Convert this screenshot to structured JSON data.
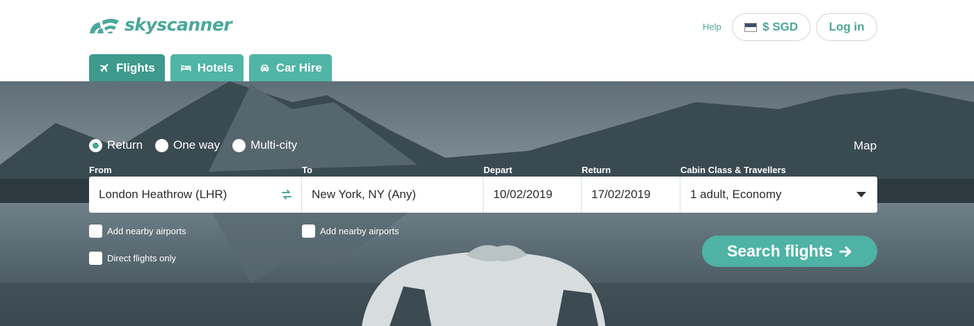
{
  "brand": {
    "name": "skyscanner",
    "accent_color": "#4aa79a"
  },
  "header": {
    "help": "Help",
    "currency": "$ SGD",
    "currency_icon": "flag-icon",
    "login": "Log in"
  },
  "tabs": [
    {
      "label": "Flights",
      "icon": "plane-icon",
      "active": true
    },
    {
      "label": "Hotels",
      "icon": "bed-icon",
      "active": false
    },
    {
      "label": "Car Hire",
      "icon": "car-icon",
      "active": false
    }
  ],
  "trip_types": [
    {
      "label": "Return",
      "selected": true
    },
    {
      "label": "One way",
      "selected": false
    },
    {
      "label": "Multi-city",
      "selected": false
    }
  ],
  "map_link": "Map",
  "form": {
    "from": {
      "label": "From",
      "value": "London Heathrow (LHR)"
    },
    "to": {
      "label": "To",
      "value": "New York, NY (Any)"
    },
    "depart": {
      "label": "Depart",
      "value": "10/02/2019"
    },
    "return": {
      "label": "Return",
      "value": "17/02/2019"
    },
    "cabin": {
      "label": "Cabin Class & Travellers",
      "value": "1 adult, Economy"
    }
  },
  "options": {
    "nearby_from": "Add nearby airports",
    "nearby_to": "Add nearby airports",
    "direct": "Direct flights only"
  },
  "search_button": "Search flights"
}
